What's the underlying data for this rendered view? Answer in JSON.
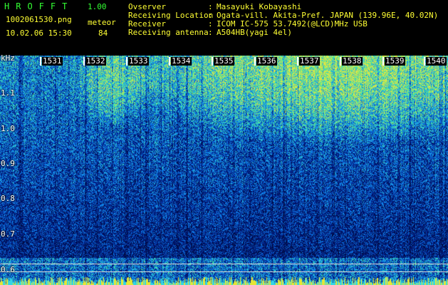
{
  "header": {
    "logo": "HROFFT",
    "version": "1.00",
    "filename": "1002061530.png",
    "meteor_label": "meteor",
    "timestamp": "10.02.06 15:30",
    "meteor_count": "84"
  },
  "info": [
    {
      "label": "Ovserver",
      "value": "Masayuki Kobayashi"
    },
    {
      "label": "Receiving Location",
      "value": "Ogata-vill. Akita-Pref. JAPAN (139.96E, 40.02N)"
    },
    {
      "label": "Receiver",
      "value": "ICOM IC-575 53.7492(@LCD)MHz USB"
    },
    {
      "label": "Receiving antenna",
      "value": "A504HB(yagi 4el)"
    }
  ],
  "axis": {
    "unit": "kHz",
    "freq_ticks": [
      "1.1",
      "1.0",
      "0.9",
      "0.8",
      "0.7",
      "0.6"
    ],
    "time_ticks": [
      "1531",
      "1532",
      "1533",
      "1534",
      "1535",
      "1536",
      "1537",
      "1538",
      "1539",
      "1540"
    ]
  },
  "colors": {
    "background": "#000000",
    "text_yellow": "#ffff33",
    "text_green": "#33ff33",
    "spectrum_low": "#0a1f8a",
    "spectrum_mid": "#1e6ee6",
    "spectrum_high": "#3ce6b4"
  }
}
